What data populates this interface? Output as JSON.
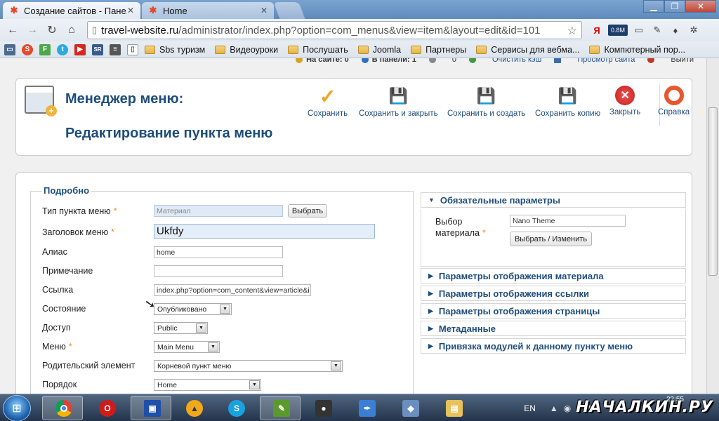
{
  "browser": {
    "tabs": [
      {
        "title": "Создание сайтов - Панель",
        "icon": "joomla-icon"
      },
      {
        "title": "Home",
        "icon": "joomla-icon"
      }
    ],
    "url_host": "travel-website.ru",
    "url_path": "/administrator/index.php?option=com_menus&view=item&layout=edit&id=101",
    "speed_badge": "0.8M",
    "yandex_label": "Я"
  },
  "bookmarks": [
    {
      "label": "Sbs туризм"
    },
    {
      "label": "Видеоуроки"
    },
    {
      "label": "Послушать"
    },
    {
      "label": "Joomla"
    },
    {
      "label": "Партнеры"
    },
    {
      "label": "Сервисы для вебма..."
    },
    {
      "label": "Компютерный пор..."
    }
  ],
  "status_strip": {
    "on_site": "На сайте: 0",
    "in_panel": "В панели: 1",
    "messages": "0",
    "clear_cache": "Очистить кэш",
    "view_site": "Просмотр сайта",
    "logout": "Выйти"
  },
  "header": {
    "title": "Менеджер меню:",
    "subtitle": "Редактирование пункта меню",
    "buttons": {
      "save": "Сохранить",
      "save_close": "Сохранить и закрыть",
      "save_new": "Сохранить и создать",
      "save_copy": "Сохранить копию",
      "close": "Закрыть",
      "help": "Справка"
    }
  },
  "details": {
    "legend": "Подробно",
    "fields": {
      "item_type": {
        "label": "Тип пункта меню",
        "value": "Материал",
        "button": "Выбрать"
      },
      "title": {
        "label": "Заголовок меню",
        "value": "Ukfdy"
      },
      "alias": {
        "label": "Алиас",
        "value": "home"
      },
      "note": {
        "label": "Примечание",
        "value": ""
      },
      "link": {
        "label": "Ссылка",
        "value": "index.php?option=com_content&view=article&i"
      },
      "state": {
        "label": "Состояние",
        "value": "Опубликовано"
      },
      "access": {
        "label": "Доступ",
        "value": "Public"
      },
      "menu": {
        "label": "Меню",
        "value": "Main Menu"
      },
      "parent": {
        "label": "Родительский элемент",
        "value": "Корневой пункт меню"
      },
      "order": {
        "label": "Порядок",
        "value": "Home"
      }
    },
    "required_mark": "*"
  },
  "sidebar": {
    "required_panel": {
      "title": "Обязательные параметры",
      "select_label": "Выбор материала",
      "select_value": "Nano Theme",
      "select_button": "Выбрать / Изменить"
    },
    "panels": [
      {
        "title": "Параметры отображения материала"
      },
      {
        "title": "Параметры отображения ссылки"
      },
      {
        "title": "Параметры отображения страницы"
      },
      {
        "title": "Метаданные"
      },
      {
        "title": "Привязка модулей к данному пункту меню"
      }
    ]
  },
  "taskbar": {
    "lang": "EN",
    "clock": "22:55",
    "brand": "НАЧАЛКИН.РУ"
  }
}
